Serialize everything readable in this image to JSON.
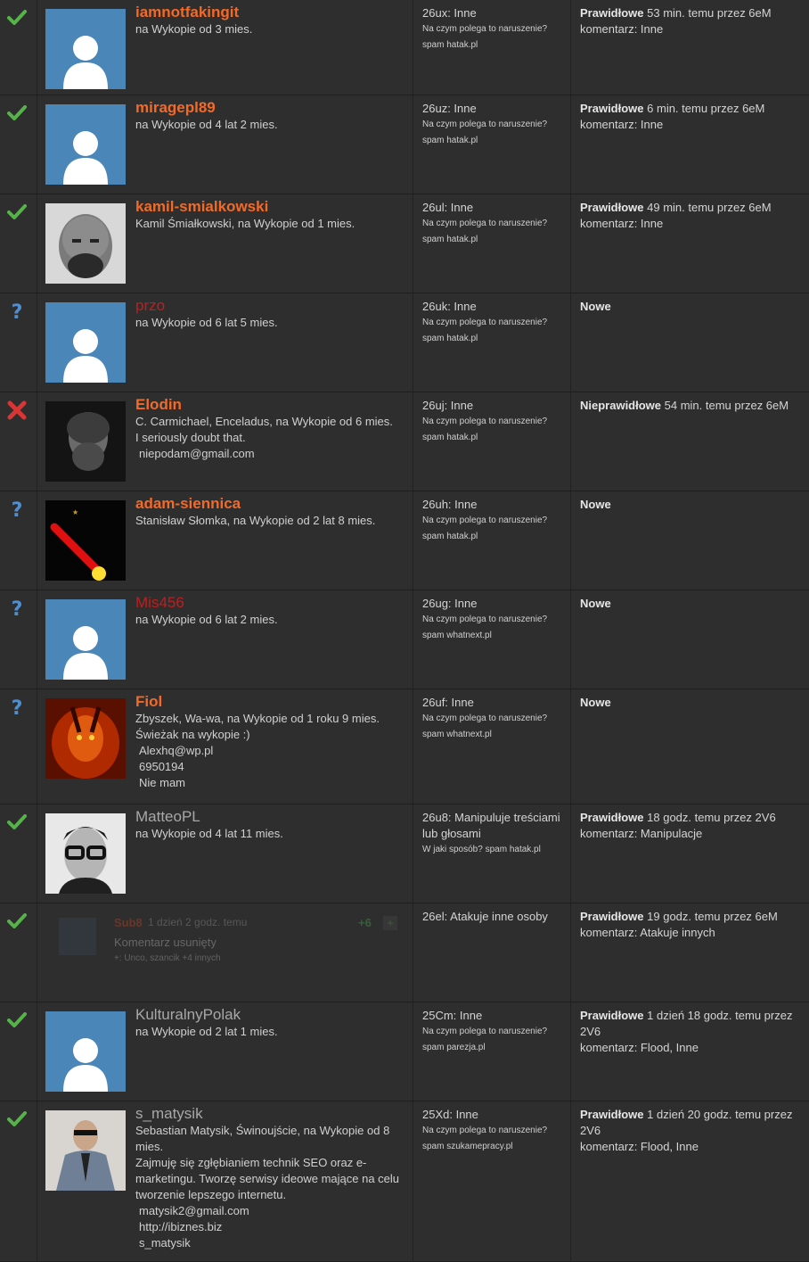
{
  "colors": {
    "accept": "#56b34a",
    "reject": "#d93535",
    "unknown": "#4f8fd1",
    "username_orange": "#f36a28",
    "username_red": "#c41c1c",
    "username_gray": "#a8a8a8"
  },
  "rows": [
    {
      "status": "accepted",
      "status_icon": "checkmark-icon",
      "username": "iamnotfakingit",
      "name_style": "orange",
      "avatar": "default",
      "info": [
        "na Wykopie od 3 mies."
      ],
      "report_id": "26ux: Inne",
      "report_q": "Na czym polega to naruszenie?",
      "report_a": "spam hatak.pl",
      "result_label": "Prawidłowe",
      "result_rest": " 53 min. temu przez 6eM",
      "comment": "komentarz: Inne"
    },
    {
      "status": "accepted",
      "status_icon": "checkmark-icon",
      "username": "miragepl89",
      "name_style": "orange",
      "avatar": "default",
      "info": [
        "na Wykopie od 4 lat 2 mies."
      ],
      "report_id": "26uz: Inne",
      "report_q": "Na czym polega to naruszenie?",
      "report_a": "spam hatak.pl",
      "result_label": "Prawidłowe",
      "result_rest": " 6 min. temu przez 6eM",
      "comment": "komentarz: Inne"
    },
    {
      "status": "accepted",
      "status_icon": "checkmark-icon",
      "username": "kamil-smialkowski",
      "name_style": "orange",
      "avatar": "photo-bald-man",
      "info": [
        "Kamil Śmiałkowski, na Wykopie od 1 mies."
      ],
      "report_id": "26ul: Inne",
      "report_q": "Na czym polega to naruszenie?",
      "report_a": "spam hatak.pl",
      "result_label": "Prawidłowe",
      "result_rest": " 49 min. temu przez 6eM",
      "comment": "komentarz: Inne"
    },
    {
      "status": "new",
      "status_icon": "question-mark-icon",
      "username": "przo",
      "name_style": "red",
      "avatar": "default",
      "info": [
        "na Wykopie od 6 lat 5 mies."
      ],
      "report_id": "26uk: Inne",
      "report_q": "Na czym polega to naruszenie?",
      "report_a": "spam hatak.pl",
      "result_label": "Nowe",
      "result_rest": "",
      "comment": ""
    },
    {
      "status": "rejected",
      "status_icon": "cross-icon",
      "username": "Elodin",
      "name_style": "orange",
      "avatar": "photo-bearded-man",
      "info": [
        "C. Carmichael, Enceladus, na Wykopie od 6 mies.",
        "I seriously doubt that."
      ],
      "info_indented": [
        "niepodam@gmail.com"
      ],
      "report_id": "26uj: Inne",
      "report_q": "Na czym polega to naruszenie?",
      "report_a": "spam hatak.pl",
      "result_label": "Nieprawidłowe",
      "result_rest": " 54 min. temu przez 6eM",
      "comment": ""
    },
    {
      "status": "new",
      "status_icon": "question-mark-icon",
      "username": "adam-siennica",
      "name_style": "orange",
      "avatar": "photo-lightsaber",
      "info": [
        "Stanisław Słomka, na Wykopie od 2 lat 8 mies."
      ],
      "report_id": "26uh: Inne",
      "report_q": "Na czym polega to naruszenie?",
      "report_a": "spam hatak.pl",
      "result_label": "Nowe",
      "result_rest": "",
      "comment": ""
    },
    {
      "status": "new",
      "status_icon": "question-mark-icon",
      "username": "Mis456",
      "name_style": "red",
      "avatar": "default",
      "info": [
        "na Wykopie od 6 lat 2 mies."
      ],
      "report_id": "26ug: Inne",
      "report_q": "Na czym polega to naruszenie?",
      "report_a": "spam whatnext.pl",
      "result_label": "Nowe",
      "result_rest": "",
      "comment": ""
    },
    {
      "status": "new",
      "status_icon": "question-mark-icon",
      "username": "Fiol",
      "name_style": "orange",
      "avatar": "photo-fire-demon",
      "info": [
        "Zbyszek, Wa-wa, na Wykopie od 1 roku 9 mies.",
        "Świeżak na wykopie :)"
      ],
      "info_indented": [
        "Alexhq@wp.pl",
        "6950194",
        "Nie mam"
      ],
      "report_id": "26uf: Inne",
      "report_q": "Na czym polega to naruszenie?",
      "report_a": "spam whatnext.pl",
      "result_label": "Nowe",
      "result_rest": "",
      "comment": ""
    },
    {
      "status": "accepted",
      "status_icon": "checkmark-icon",
      "username": "MatteoPL",
      "name_style": "gray",
      "avatar": "photo-glasses-man",
      "info": [
        "na Wykopie od 4 lat 11 mies."
      ],
      "report_id": "26u8: Manipuluje treściami lub głosami",
      "report_q": "W jaki sposób? spam hatak.pl",
      "report_a": "",
      "result_label": "Prawidłowe",
      "result_rest": " 18 godz. temu przez 2V6",
      "comment": "komentarz: Manipulacje"
    },
    {
      "status": "accepted",
      "status_icon": "checkmark-icon",
      "deleted": true,
      "deleted_user": "Sub8",
      "deleted_time": "1 dzień 2 godz. temu",
      "deleted_votes": "+6",
      "deleted_plus": "+",
      "deleted_text": "Komentarz usunięty",
      "deleted_voters": "+: Unco, szancik +4 innych",
      "report_id": "26el: Atakuje inne osoby",
      "report_q": "",
      "report_a": "",
      "result_label": "Prawidłowe",
      "result_rest": " 19 godz. temu przez 6eM",
      "comment": "komentarz: Atakuje innych"
    },
    {
      "status": "accepted",
      "status_icon": "checkmark-icon",
      "username": "KulturalnyPolak",
      "name_style": "gray",
      "avatar": "default",
      "info": [
        "na Wykopie od 2 lat 1 mies."
      ],
      "report_id": "25Cm: Inne",
      "report_q": "Na czym polega to naruszenie?",
      "report_a": "spam parezja.pl",
      "result_label": "Prawidłowe",
      "result_rest": " 1 dzień 18 godz. temu przez 2V6",
      "comment": "komentarz: Flood, Inne"
    },
    {
      "status": "accepted",
      "status_icon": "checkmark-icon",
      "username": "s_matysik",
      "name_style": "gray",
      "avatar": "photo-suit-man",
      "info": [
        "Sebastian Matysik, Świnoujście, na Wykopie od 8 mies.",
        "Zajmuję się zgłębianiem technik SEO oraz e-marketingu. Tworzę serwisy ideowe mające na celu tworzenie lepszego internetu."
      ],
      "info_indented": [
        "matysik2@gmail.com",
        "http://ibiznes.biz",
        "s_matysik"
      ],
      "report_id": "25Xd: Inne",
      "report_q": "Na czym polega to naruszenie?",
      "report_a": "spam szukamepracy.pl",
      "result_label": "Prawidłowe",
      "result_rest": " 1 dzień 20 godz. temu przez 2V6",
      "comment": "komentarz: Flood, Inne"
    }
  ]
}
